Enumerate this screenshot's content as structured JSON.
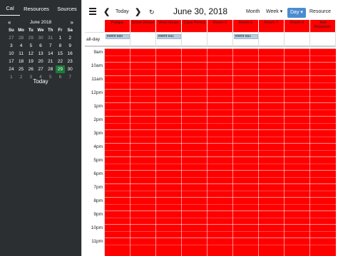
{
  "sidebar": {
    "tabs": [
      "Cal",
      "Resources",
      "Sources"
    ],
    "mini_calendar": {
      "month_label": "June 2018",
      "prev": "«",
      "next": "»",
      "dow": [
        "Su",
        "Mo",
        "Tu",
        "We",
        "Th",
        "Fr",
        "Sa"
      ],
      "weeks": [
        [
          "27",
          "28",
          "29",
          "30",
          "31",
          "1",
          "2"
        ],
        [
          "3",
          "4",
          "5",
          "6",
          "7",
          "8",
          "9"
        ],
        [
          "10",
          "11",
          "12",
          "13",
          "14",
          "15",
          "16"
        ],
        [
          "17",
          "18",
          "19",
          "20",
          "21",
          "22",
          "23"
        ],
        [
          "24",
          "25",
          "26",
          "27",
          "28",
          "29",
          "30"
        ],
        [
          "1",
          "2",
          "3",
          "4",
          "5",
          "6",
          "7"
        ]
      ],
      "selected": "29"
    },
    "today_label": "Today"
  },
  "toolbar": {
    "prev": "❮",
    "today": "Today",
    "next": "❯",
    "refresh": "↻",
    "title": "June 30, 2018",
    "month": "Month",
    "week": "Week ▾",
    "day": "Day ▾",
    "resource": "Resource"
  },
  "resources": [
    "Palapa",
    "Stone House",
    "Vera House",
    "Casa Piedra",
    "Room 6",
    "Room 6",
    "Room 7",
    "Room 8",
    "Test Resource"
  ],
  "allday_label": "all-day",
  "events": [
    {
      "label": "event 689",
      "col": 0
    },
    {
      "label": "event 691",
      "col": 2
    },
    {
      "label": "event 682",
      "col": 5
    }
  ],
  "times": [
    "9am",
    "10am",
    "11am",
    "12pm",
    "1pm",
    "2pm",
    "3pm",
    "4pm",
    "5pm",
    "6pm",
    "7pm",
    "8pm",
    "9pm",
    "10pm",
    "11pm"
  ],
  "colors": {
    "resource_bg": "#ff0000",
    "sidebar_bg": "#2b2f31",
    "selected_day": "#1b7a3a",
    "active_button": "#4a8ccf",
    "event_bg": "#b9cfe0"
  }
}
